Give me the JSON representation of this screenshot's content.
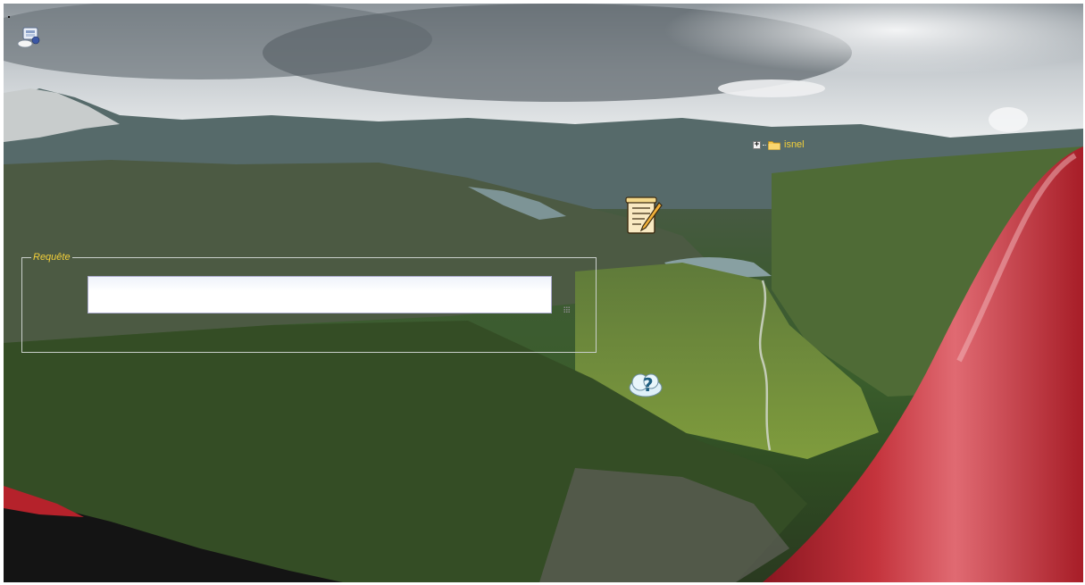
{
  "tree": {
    "expander": "+",
    "node_label": "isnel",
    "folder_icon": "folder-icon"
  },
  "requete": {
    "legend": "Requête",
    "value": "",
    "placeholder": ""
  },
  "icons": {
    "top_left": "weather-map-icon",
    "notepad": "notepad-pen-icon",
    "help": "help-cloud-icon"
  },
  "colors": {
    "label_accent": "#f2cf3a",
    "fieldset_border": "#c9cfcb"
  }
}
